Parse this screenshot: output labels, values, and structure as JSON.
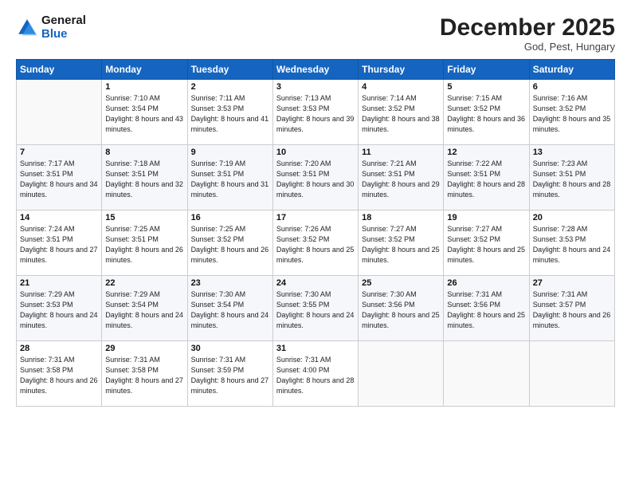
{
  "logo": {
    "line1": "General",
    "line2": "Blue"
  },
  "header": {
    "month": "December 2025",
    "location": "God, Pest, Hungary"
  },
  "days_of_week": [
    "Sunday",
    "Monday",
    "Tuesday",
    "Wednesday",
    "Thursday",
    "Friday",
    "Saturday"
  ],
  "weeks": [
    [
      {
        "day": "",
        "sunrise": "",
        "sunset": "",
        "daylight": ""
      },
      {
        "day": "1",
        "sunrise": "Sunrise: 7:10 AM",
        "sunset": "Sunset: 3:54 PM",
        "daylight": "Daylight: 8 hours and 43 minutes."
      },
      {
        "day": "2",
        "sunrise": "Sunrise: 7:11 AM",
        "sunset": "Sunset: 3:53 PM",
        "daylight": "Daylight: 8 hours and 41 minutes."
      },
      {
        "day": "3",
        "sunrise": "Sunrise: 7:13 AM",
        "sunset": "Sunset: 3:53 PM",
        "daylight": "Daylight: 8 hours and 39 minutes."
      },
      {
        "day": "4",
        "sunrise": "Sunrise: 7:14 AM",
        "sunset": "Sunset: 3:52 PM",
        "daylight": "Daylight: 8 hours and 38 minutes."
      },
      {
        "day": "5",
        "sunrise": "Sunrise: 7:15 AM",
        "sunset": "Sunset: 3:52 PM",
        "daylight": "Daylight: 8 hours and 36 minutes."
      },
      {
        "day": "6",
        "sunrise": "Sunrise: 7:16 AM",
        "sunset": "Sunset: 3:52 PM",
        "daylight": "Daylight: 8 hours and 35 minutes."
      }
    ],
    [
      {
        "day": "7",
        "sunrise": "Sunrise: 7:17 AM",
        "sunset": "Sunset: 3:51 PM",
        "daylight": "Daylight: 8 hours and 34 minutes."
      },
      {
        "day": "8",
        "sunrise": "Sunrise: 7:18 AM",
        "sunset": "Sunset: 3:51 PM",
        "daylight": "Daylight: 8 hours and 32 minutes."
      },
      {
        "day": "9",
        "sunrise": "Sunrise: 7:19 AM",
        "sunset": "Sunset: 3:51 PM",
        "daylight": "Daylight: 8 hours and 31 minutes."
      },
      {
        "day": "10",
        "sunrise": "Sunrise: 7:20 AM",
        "sunset": "Sunset: 3:51 PM",
        "daylight": "Daylight: 8 hours and 30 minutes."
      },
      {
        "day": "11",
        "sunrise": "Sunrise: 7:21 AM",
        "sunset": "Sunset: 3:51 PM",
        "daylight": "Daylight: 8 hours and 29 minutes."
      },
      {
        "day": "12",
        "sunrise": "Sunrise: 7:22 AM",
        "sunset": "Sunset: 3:51 PM",
        "daylight": "Daylight: 8 hours and 28 minutes."
      },
      {
        "day": "13",
        "sunrise": "Sunrise: 7:23 AM",
        "sunset": "Sunset: 3:51 PM",
        "daylight": "Daylight: 8 hours and 28 minutes."
      }
    ],
    [
      {
        "day": "14",
        "sunrise": "Sunrise: 7:24 AM",
        "sunset": "Sunset: 3:51 PM",
        "daylight": "Daylight: 8 hours and 27 minutes."
      },
      {
        "day": "15",
        "sunrise": "Sunrise: 7:25 AM",
        "sunset": "Sunset: 3:51 PM",
        "daylight": "Daylight: 8 hours and 26 minutes."
      },
      {
        "day": "16",
        "sunrise": "Sunrise: 7:25 AM",
        "sunset": "Sunset: 3:52 PM",
        "daylight": "Daylight: 8 hours and 26 minutes."
      },
      {
        "day": "17",
        "sunrise": "Sunrise: 7:26 AM",
        "sunset": "Sunset: 3:52 PM",
        "daylight": "Daylight: 8 hours and 25 minutes."
      },
      {
        "day": "18",
        "sunrise": "Sunrise: 7:27 AM",
        "sunset": "Sunset: 3:52 PM",
        "daylight": "Daylight: 8 hours and 25 minutes."
      },
      {
        "day": "19",
        "sunrise": "Sunrise: 7:27 AM",
        "sunset": "Sunset: 3:52 PM",
        "daylight": "Daylight: 8 hours and 25 minutes."
      },
      {
        "day": "20",
        "sunrise": "Sunrise: 7:28 AM",
        "sunset": "Sunset: 3:53 PM",
        "daylight": "Daylight: 8 hours and 24 minutes."
      }
    ],
    [
      {
        "day": "21",
        "sunrise": "Sunrise: 7:29 AM",
        "sunset": "Sunset: 3:53 PM",
        "daylight": "Daylight: 8 hours and 24 minutes."
      },
      {
        "day": "22",
        "sunrise": "Sunrise: 7:29 AM",
        "sunset": "Sunset: 3:54 PM",
        "daylight": "Daylight: 8 hours and 24 minutes."
      },
      {
        "day": "23",
        "sunrise": "Sunrise: 7:30 AM",
        "sunset": "Sunset: 3:54 PM",
        "daylight": "Daylight: 8 hours and 24 minutes."
      },
      {
        "day": "24",
        "sunrise": "Sunrise: 7:30 AM",
        "sunset": "Sunset: 3:55 PM",
        "daylight": "Daylight: 8 hours and 24 minutes."
      },
      {
        "day": "25",
        "sunrise": "Sunrise: 7:30 AM",
        "sunset": "Sunset: 3:56 PM",
        "daylight": "Daylight: 8 hours and 25 minutes."
      },
      {
        "day": "26",
        "sunrise": "Sunrise: 7:31 AM",
        "sunset": "Sunset: 3:56 PM",
        "daylight": "Daylight: 8 hours and 25 minutes."
      },
      {
        "day": "27",
        "sunrise": "Sunrise: 7:31 AM",
        "sunset": "Sunset: 3:57 PM",
        "daylight": "Daylight: 8 hours and 26 minutes."
      }
    ],
    [
      {
        "day": "28",
        "sunrise": "Sunrise: 7:31 AM",
        "sunset": "Sunset: 3:58 PM",
        "daylight": "Daylight: 8 hours and 26 minutes."
      },
      {
        "day": "29",
        "sunrise": "Sunrise: 7:31 AM",
        "sunset": "Sunset: 3:58 PM",
        "daylight": "Daylight: 8 hours and 27 minutes."
      },
      {
        "day": "30",
        "sunrise": "Sunrise: 7:31 AM",
        "sunset": "Sunset: 3:59 PM",
        "daylight": "Daylight: 8 hours and 27 minutes."
      },
      {
        "day": "31",
        "sunrise": "Sunrise: 7:31 AM",
        "sunset": "Sunset: 4:00 PM",
        "daylight": "Daylight: 8 hours and 28 minutes."
      },
      {
        "day": "",
        "sunrise": "",
        "sunset": "",
        "daylight": ""
      },
      {
        "day": "",
        "sunrise": "",
        "sunset": "",
        "daylight": ""
      },
      {
        "day": "",
        "sunrise": "",
        "sunset": "",
        "daylight": ""
      }
    ]
  ]
}
